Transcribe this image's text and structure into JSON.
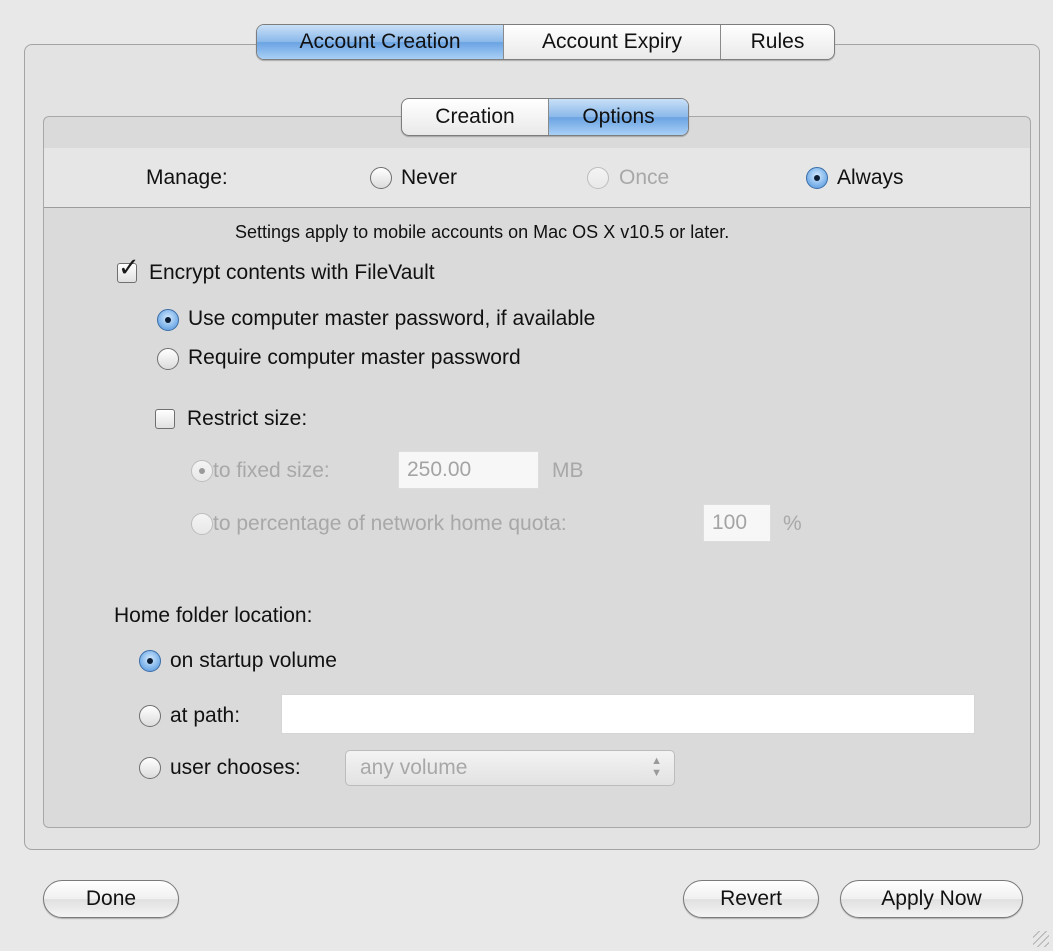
{
  "top_tabs": [
    {
      "label": "Account Creation",
      "selected": true
    },
    {
      "label": "Account Expiry",
      "selected": false
    },
    {
      "label": "Rules",
      "selected": false
    }
  ],
  "sub_tabs": [
    {
      "label": "Creation",
      "selected": false
    },
    {
      "label": "Options",
      "selected": true
    }
  ],
  "manage": {
    "label": "Manage:",
    "never": "Never",
    "once": "Once",
    "always": "Always",
    "selected": "Always"
  },
  "note": "Settings apply to mobile accounts on Mac OS X v10.5 or later.",
  "filevault": {
    "encrypt_label": "Encrypt contents with FileVault",
    "encrypt_checked": true,
    "use_master_label": "Use computer master password, if available",
    "require_master_label": "Require computer master password",
    "selected": "use_master"
  },
  "restrict": {
    "label": "Restrict size:",
    "checked": false,
    "fixed_label": "to fixed size:",
    "fixed_value": "250.00",
    "fixed_unit": "MB",
    "percent_label": "to percentage of network home quota:",
    "percent_value": "100",
    "percent_unit": "%"
  },
  "home": {
    "label": "Home folder location:",
    "startup_label": "on startup volume",
    "path_label": "at path:",
    "path_value": "",
    "user_label": "user chooses:",
    "user_value": "any volume",
    "selected": "startup"
  },
  "buttons": {
    "done": "Done",
    "revert": "Revert",
    "apply": "Apply Now"
  }
}
